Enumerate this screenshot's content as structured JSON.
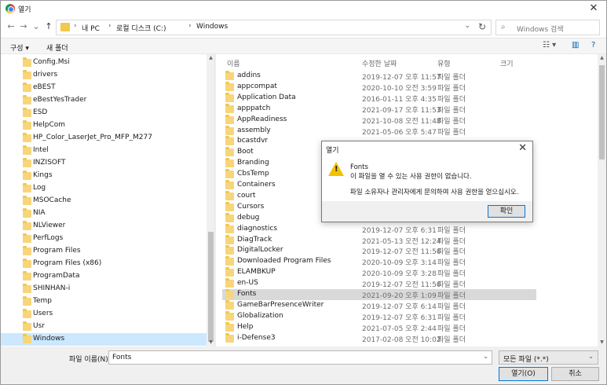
{
  "window": {
    "title": "열기",
    "close_glyph": "✕"
  },
  "nav": {
    "back_glyph": "←",
    "forward_glyph": "→",
    "recent_glyph": "⌄",
    "up_glyph": "↑",
    "breadcrumb": [
      "내 PC",
      "로컬 디스크 (C:)",
      "Windows"
    ],
    "separator": "›",
    "dropdown_glyph": "⌄",
    "refresh_glyph": "↻",
    "search_placeholder": "Windows 검색",
    "search_glyph": "⌕"
  },
  "toolbar": {
    "organize_label": "구성 ▾",
    "new_folder_label": "새 폴더",
    "view_glyph": "☷ ▾",
    "pane_glyph": "▥",
    "help_glyph": "?"
  },
  "sidebar": {
    "items": [
      {
        "label": "Config.Msi"
      },
      {
        "label": "drivers"
      },
      {
        "label": "eBEST"
      },
      {
        "label": "eBestYesTrader"
      },
      {
        "label": "ESD"
      },
      {
        "label": "HelpCom"
      },
      {
        "label": "HP_Color_LaserJet_Pro_MFP_M277"
      },
      {
        "label": "Intel"
      },
      {
        "label": "INZISOFT"
      },
      {
        "label": "Kings"
      },
      {
        "label": "Log"
      },
      {
        "label": "MSOCache"
      },
      {
        "label": "NIA"
      },
      {
        "label": "NLViewer"
      },
      {
        "label": "PerfLogs"
      },
      {
        "label": "Program Files"
      },
      {
        "label": "Program Files (x86)"
      },
      {
        "label": "ProgramData"
      },
      {
        "label": "SHINHAN-i"
      },
      {
        "label": "Temp"
      },
      {
        "label": "Users"
      },
      {
        "label": "Usr"
      },
      {
        "label": "Windows"
      }
    ],
    "selected_index": 22
  },
  "list": {
    "columns": {
      "name": "이름",
      "date": "수정한 날짜",
      "type": "유형",
      "size": "크기"
    },
    "sort_glyph": "^",
    "rows": [
      {
        "name": "addins",
        "date": "2019-12-07 오후 11:57",
        "type": "파일 폴더"
      },
      {
        "name": "appcompat",
        "date": "2020-10-10 오전 3:59",
        "type": "파일 폴더"
      },
      {
        "name": "Application Data",
        "date": "2016-01-11 오후 4:35",
        "type": "파일 폴더"
      },
      {
        "name": "apppatch",
        "date": "2021-09-17 오후 11:53",
        "type": "파일 폴더"
      },
      {
        "name": "AppReadiness",
        "date": "2021-10-08 오전 11:48",
        "type": "파일 폴더"
      },
      {
        "name": "assembly",
        "date": "2021-05-06 오후 5:47",
        "type": "파일 폴더"
      },
      {
        "name": "bcastdvr",
        "date": "",
        "type": ""
      },
      {
        "name": "Boot",
        "date": "",
        "type": ""
      },
      {
        "name": "Branding",
        "date": "",
        "type": ""
      },
      {
        "name": "CbsTemp",
        "date": "",
        "type": ""
      },
      {
        "name": "Containers",
        "date": "",
        "type": ""
      },
      {
        "name": "court",
        "date": "",
        "type": ""
      },
      {
        "name": "Cursors",
        "date": "",
        "type": ""
      },
      {
        "name": "debug",
        "date": "",
        "type": ""
      },
      {
        "name": "diagnostics",
        "date": "2019-12-07 오후 6:31",
        "type": "파일 폴더"
      },
      {
        "name": "DiagTrack",
        "date": "2021-05-13 오전 12:24",
        "type": "파일 폴더"
      },
      {
        "name": "DigitalLocker",
        "date": "2019-12-07 오전 11:56",
        "type": "파일 폴더"
      },
      {
        "name": "Downloaded Program Files",
        "date": "2020-10-09 오후 3:14",
        "type": "파일 폴더"
      },
      {
        "name": "ELAMBKUP",
        "date": "2020-10-09 오후 3:28",
        "type": "파일 폴더"
      },
      {
        "name": "en-US",
        "date": "2019-12-07 오전 11:56",
        "type": "파일 폴더"
      },
      {
        "name": "Fonts",
        "date": "2021-09-20 오후 1:09",
        "type": "파일 폴더"
      },
      {
        "name": "GameBarPresenceWriter",
        "date": "2019-12-07 오후 6:14",
        "type": "파일 폴더"
      },
      {
        "name": "Globalization",
        "date": "2019-12-07 오후 6:31",
        "type": "파일 폴더"
      },
      {
        "name": "Help",
        "date": "2021-07-05 오후 2:44",
        "type": "파일 폴더"
      },
      {
        "name": "i-Defense3",
        "date": "2017-02-08 오전 10:02",
        "type": "파일 폴더"
      }
    ],
    "selected_index": 20
  },
  "bottom": {
    "filename_label": "파일 이름(N):",
    "filename_value": "Fonts",
    "filter_value": "모든 파일 (*.*)",
    "open_label": "열기(O)",
    "cancel_label": "취소",
    "dropdown_glyph": "⌄"
  },
  "dialog": {
    "title": "열기",
    "close_glyph": "✕",
    "warn_glyph": "!",
    "line1": "Fonts",
    "line2": "이 파일을 열 수 있는 사용 권한이 없습니다.",
    "line3": "파일 소유자나 관리자에게 문의하여 사용 권한을 얻으십시오.",
    "ok_label": "확인"
  },
  "colors": {
    "accent": "#0078d7",
    "selection": "#cce8ff",
    "folder": "#f7d57a",
    "warning": "#f2c200"
  }
}
